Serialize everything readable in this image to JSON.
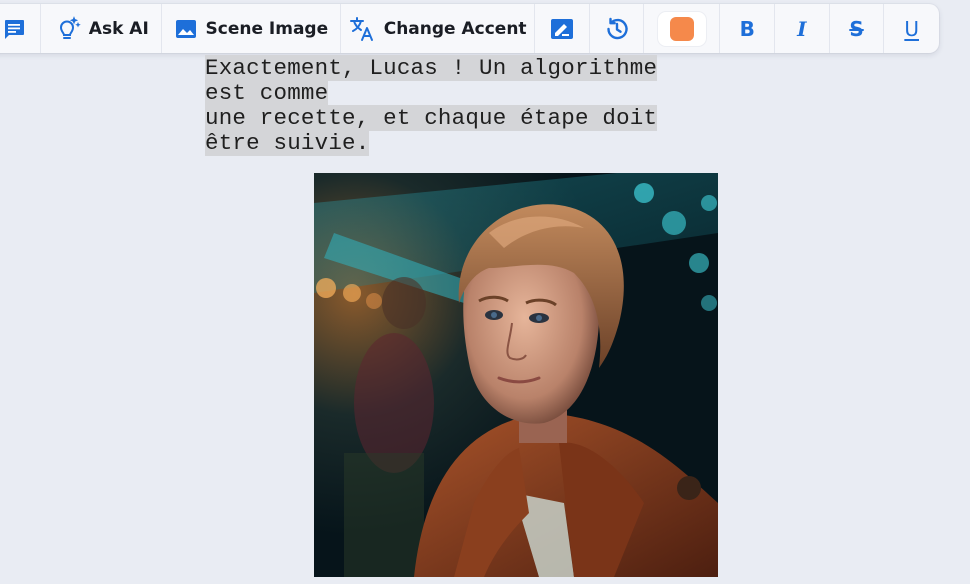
{
  "toolbar": {
    "chat_icon": "chat-bubble-icon",
    "ask_ai": {
      "icon": "lightbulb-sparkle-icon",
      "label": "Ask AI"
    },
    "scene_image": {
      "icon": "image-icon",
      "label": "Scene Image"
    },
    "change_accent": {
      "icon": "translate-icon",
      "label": "Change Accent"
    },
    "edit_icon": "edit-note-icon",
    "history_icon": "history-icon",
    "color": "#f5894b",
    "format": {
      "bold": "B",
      "italic": "I",
      "strike": "S",
      "underline": "U"
    },
    "accent_color": "#1e6fd9"
  },
  "dialogue": {
    "lines": [
      "Exactement, Lucas ! Un algorithme",
      "est comme",
      "une recette, et chaque étape doit",
      "être suivie."
    ]
  }
}
